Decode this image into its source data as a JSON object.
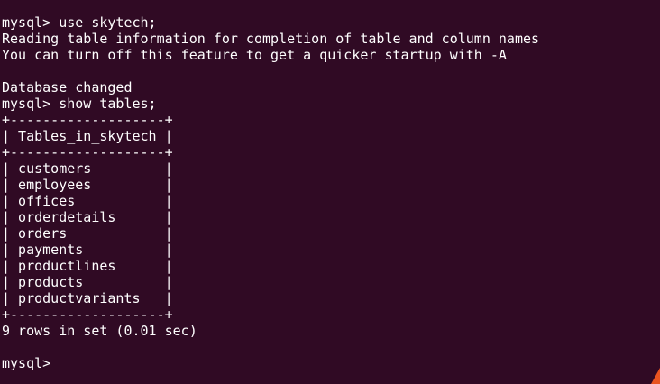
{
  "terminal": {
    "lines": [
      "mysql> use skytech;",
      "Reading table information for completion of table and column names",
      "You can turn off this feature to get a quicker startup with -A",
      "",
      "Database changed",
      "mysql> show tables;",
      "+-------------------+",
      "| Tables_in_skytech |",
      "+-------------------+",
      "| customers         |",
      "| employees         |",
      "| offices           |",
      "| orderdetails      |",
      "| orders            |",
      "| payments          |",
      "| productlines      |",
      "| products          |",
      "| productvariants   |",
      "+-------------------+",
      "9 rows in set (0.01 sec)",
      "",
      "mysql> "
    ]
  },
  "colors": {
    "background": "#300a24",
    "foreground": "#ffffff",
    "accent": "#e95420"
  }
}
